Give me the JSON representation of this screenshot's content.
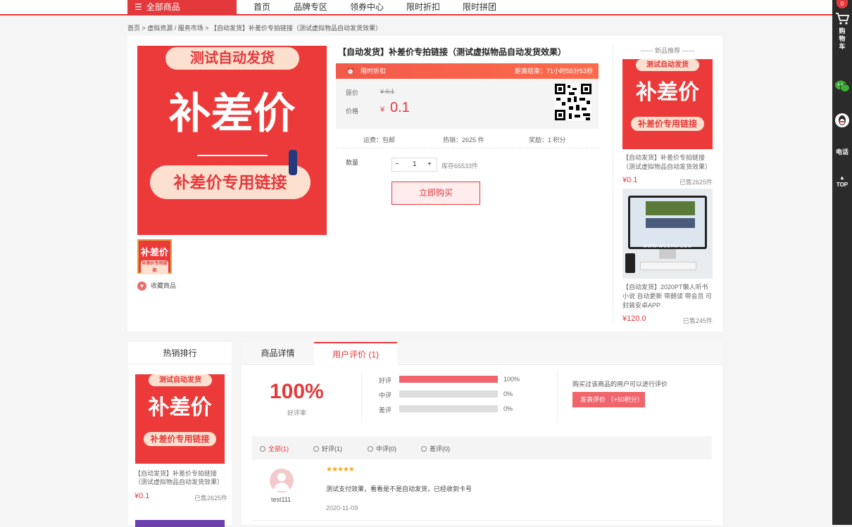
{
  "nav": {
    "all_categories": "全部商品",
    "items": [
      "首页",
      "品牌专区",
      "领券中心",
      "限时折扣",
      "限时拼团"
    ]
  },
  "breadcrumb": "首页 > 虚拟资源 / 服务市场 > 【自动发货】补差价专拍链接（测试虚拟物品自动发货效果）",
  "product": {
    "image_top": "测试自动发货",
    "image_main": "补差价",
    "image_sub": "补差价专用链接",
    "thumb_main": "补差价",
    "thumb_sub": "补差价专用链接",
    "favorite": "收藏商品",
    "title": "【自动发货】补差价专拍链接（测试虚拟物品自动发货效果）",
    "flash_label": "限时折扣",
    "countdown": "距离结束：71小时55分53秒",
    "orig_label": "原价",
    "orig_price": "¥ 0.1",
    "price_label": "价格",
    "price_currency": "¥",
    "price_value": "0.1",
    "shipping": "运费：包邮",
    "hot_sales": "热销：2625 件",
    "reward": "奖励：1 积分",
    "qty_label": "数量",
    "qty_minus": "−",
    "qty_value": "1",
    "qty_plus": "+",
    "stock": "库存65533件",
    "buy_now": "立即购买"
  },
  "recommend": {
    "title": "新品推荐",
    "items": [
      {
        "img_top": "测试自动发货",
        "img_main": "补差价",
        "img_sub": "补差价专用链接",
        "name": "【自动发货】补差价专拍链接（测试虚拟物品自动发货效果）",
        "price": "¥0.1",
        "sold": "已售2625件"
      },
      {
        "name": "【自动发货】2020PT懒人听书小说 自动更新 带朗读 带会员 可封装安卓APP",
        "screen_text": "WWW.WUSHU.COM",
        "price": "¥120.0",
        "sold": "已售245件"
      }
    ]
  },
  "hot": {
    "title": "热销排行",
    "img_top": "测试自动发货",
    "img_main": "补差价",
    "img_sub": "补差价专用链接",
    "name": "【自动发货】补差价专拍链接（测试虚拟物品自动发货效果）",
    "price": "¥0.1",
    "sold": "已售2625件"
  },
  "tabs": [
    "商品详情",
    "用户评价 (1)"
  ],
  "reviews": {
    "rate": "100%",
    "rate_label": "好评率",
    "bars": [
      {
        "label": "好评",
        "percent": "100%",
        "fraction": 1.0
      },
      {
        "label": "中评",
        "percent": "0%",
        "fraction": 0
      },
      {
        "label": "差评",
        "percent": "0%",
        "fraction": 0
      }
    ],
    "tip": "购买过该商品的用户可以进行评价",
    "button": "发表评价 （+50积分）",
    "filters": [
      "全部(1)",
      "好评(1)",
      "中评(0)",
      "差评(0)"
    ],
    "items": [
      {
        "user": "test111",
        "stars": "★★★★★",
        "text": "测试支付效果，看看是不是自动发货，已经收到卡号",
        "date": "2020-11-09"
      }
    ]
  },
  "sidebar": {
    "cart_count": "0",
    "cart": "购\n物\n车",
    "phone": "电话",
    "top": "TOP"
  },
  "colors": {
    "accent": "#e4393c",
    "bar_fill": "#f0656b"
  }
}
